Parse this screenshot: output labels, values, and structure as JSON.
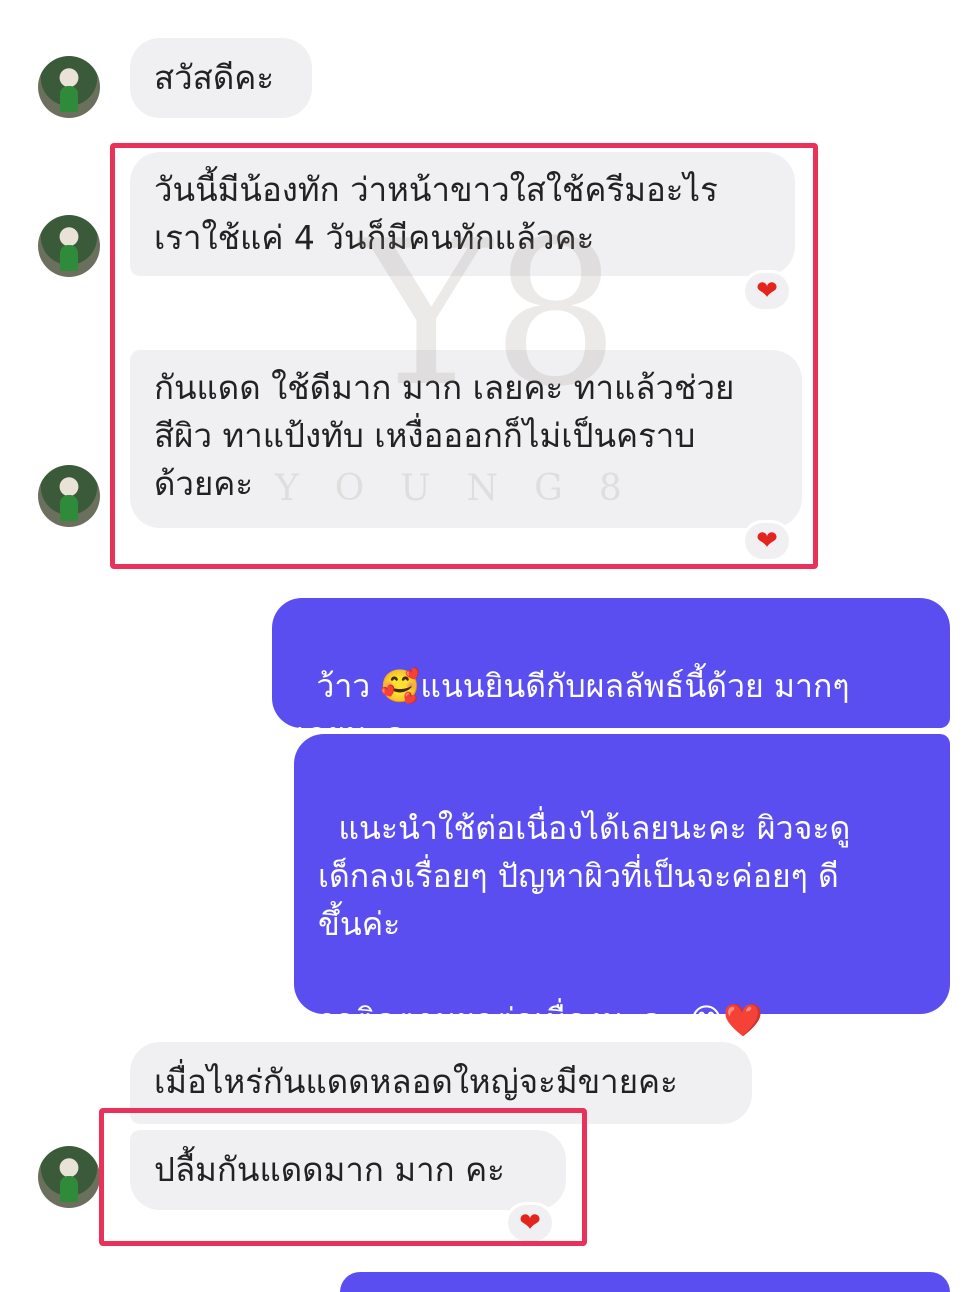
{
  "messages": {
    "greeting": "สวัสดีคะ",
    "msg1": "วันนี้มีน้องทัก ว่าหน้าขาวใสใช้ครีมอะไร\nเราใช้แค่ 4 วันก็มีคนทักแล้วคะ",
    "msg2": "กันแดด ใช้ดีมาก มาก เลยคะ ทาแล้วช่วย\nสีผิว ทาแป้งทับ เหงื่อออกก็ไม่เป็นคราบ\nด้วยคะ",
    "reply1_a": "ว้าว ",
    "reply1_emoji": "🥰",
    "reply1_b": "แนนยินดีกับผลลัพธ์นี้ด้วย มากๆ\nเลยนะคะ",
    "reply2": "แนะนำใช้ต่อเนื่องได้เลยนะคะ ผิวจะดู\nเด็กลงเรื่อยๆ ปัญหาผิวที่เป็นจะค่อยๆ ดี\nขึ้นค่ะ\n\nรอติดตามผลต่อเนื่องนะคะ ",
    "reply2_emoji": "😊❤️",
    "msg3": "เมื่อไหร่กันแดดหลอดใหญ่จะมีขายคะ",
    "msg4": "ปลื้มกันแดดมาก มาก คะ"
  },
  "reactions": {
    "heart": "❤"
  },
  "watermark": {
    "logo": "Y8",
    "text": "YOUNG8"
  },
  "colors": {
    "incoming_bubble": "#f0f0f2",
    "outgoing_bubble": "#5b4ef0",
    "highlight_border": "#e8325a",
    "heart": "#e3241f"
  }
}
